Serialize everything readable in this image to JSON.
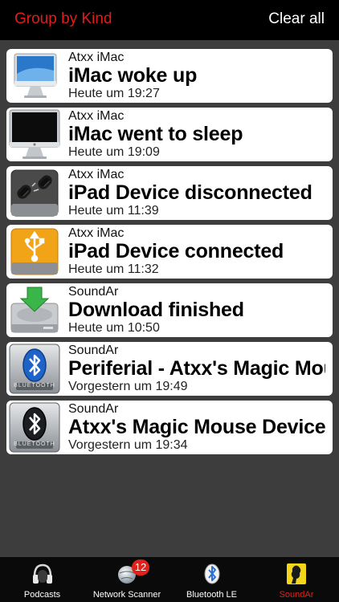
{
  "header": {
    "group_by": "Group by Kind",
    "clear_all": "Clear all"
  },
  "notifications": [
    {
      "source": "Atxx iMac",
      "message": "iMac woke up",
      "time": "Heute um 19:27",
      "icon": "imac-icon"
    },
    {
      "source": "Atxx iMac",
      "message": "iMac went to sleep",
      "time": "Heute um 19:09",
      "icon": "imac-sleep-icon"
    },
    {
      "source": "Atxx iMac",
      "message": "iPad Device disconnected",
      "time": "Heute um 11:39",
      "icon": "broken-link-drive-icon"
    },
    {
      "source": "Atxx iMac",
      "message": "iPad Device connected",
      "time": "Heute um 11:32",
      "icon": "usb-drive-icon"
    },
    {
      "source": "SoundAr",
      "message": "Download finished",
      "time": "Heute um 10:50",
      "icon": "download-drive-icon"
    },
    {
      "source": "SoundAr",
      "message": "Periferial - Atxx's Magic Mouse",
      "time": "Vorgestern um 19:49",
      "icon": "bluetooth-blue-icon",
      "icon_caption": "BLUETOOTH"
    },
    {
      "source": "SoundAr",
      "message": "Atxx's Magic Mouse Device",
      "time": "Vorgestern um 19:34",
      "icon": "bluetooth-dark-icon",
      "icon_caption": "BLUETOOTH"
    }
  ],
  "tabs": [
    {
      "label": "Podcasts",
      "icon": "headphones-icon"
    },
    {
      "label": "Network Scanner",
      "icon": "globe-icon",
      "badge": "12"
    },
    {
      "label": "Bluetooth LE",
      "icon": "bluetooth-icon"
    },
    {
      "label": "SoundAr",
      "icon": "soundar-icon",
      "active": true
    }
  ],
  "colors": {
    "accent_red": "#e0221a",
    "background": "#3d3d3d",
    "bar": "#000000"
  }
}
